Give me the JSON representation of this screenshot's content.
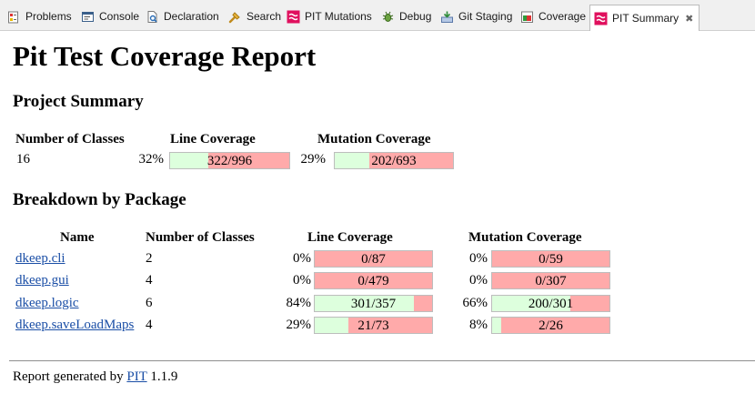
{
  "tabs": [
    {
      "label": "Problems",
      "icon": "problems-icon"
    },
    {
      "label": "Console",
      "icon": "console-icon"
    },
    {
      "label": "Declaration",
      "icon": "declaration-icon"
    },
    {
      "label": "Search",
      "icon": "search-icon"
    },
    {
      "label": "PIT Mutations",
      "icon": "pit-icon"
    },
    {
      "label": "Debug",
      "icon": "debug-icon"
    },
    {
      "label": "Git Staging",
      "icon": "git-staging-icon"
    },
    {
      "label": "Coverage",
      "icon": "coverage-icon"
    },
    {
      "label": "PIT Summary",
      "icon": "pit-icon",
      "active": true,
      "close": "✖"
    }
  ],
  "report": {
    "title": "Pit Test Coverage Report",
    "project_summary": {
      "heading": "Project Summary",
      "columns": {
        "classes": "Number of Classes",
        "line": "Line Coverage",
        "mutation": "Mutation Coverage"
      },
      "row": {
        "classes": "16",
        "line_pct": "32%",
        "line_ratio": "322/996",
        "line_fraction": 0.323,
        "mutation_pct": "29%",
        "mutation_ratio": "202/693",
        "mutation_fraction": 0.291
      }
    },
    "breakdown": {
      "heading": "Breakdown by Package",
      "columns": {
        "name": "Name",
        "classes": "Number of Classes",
        "line": "Line Coverage",
        "mutation": "Mutation Coverage"
      },
      "rows": [
        {
          "name": "dkeep.cli",
          "classes": "2",
          "line_pct": "0%",
          "line_ratio": "0/87",
          "line_fraction": 0.0,
          "mutation_pct": "0%",
          "mutation_ratio": "0/59",
          "mutation_fraction": 0.0
        },
        {
          "name": "dkeep.gui",
          "classes": "4",
          "line_pct": "0%",
          "line_ratio": "0/479",
          "line_fraction": 0.0,
          "mutation_pct": "0%",
          "mutation_ratio": "0/307",
          "mutation_fraction": 0.0
        },
        {
          "name": "dkeep.logic",
          "classes": "6",
          "line_pct": "84%",
          "line_ratio": "301/357",
          "line_fraction": 0.843,
          "mutation_pct": "66%",
          "mutation_ratio": "200/301",
          "mutation_fraction": 0.664
        },
        {
          "name": "dkeep.saveLoadMaps",
          "classes": "4",
          "line_pct": "29%",
          "line_ratio": "21/73",
          "line_fraction": 0.288,
          "mutation_pct": "8%",
          "mutation_ratio": "2/26",
          "mutation_fraction": 0.077
        }
      ]
    },
    "footer": {
      "prefix": "Report generated by",
      "link": "PIT",
      "version": "1.1.9"
    }
  },
  "colors": {
    "covered": "#ddffdd",
    "uncovered": "#ffaaaa",
    "link": "#1a4ea6",
    "pit_icon": "#e0105e"
  }
}
